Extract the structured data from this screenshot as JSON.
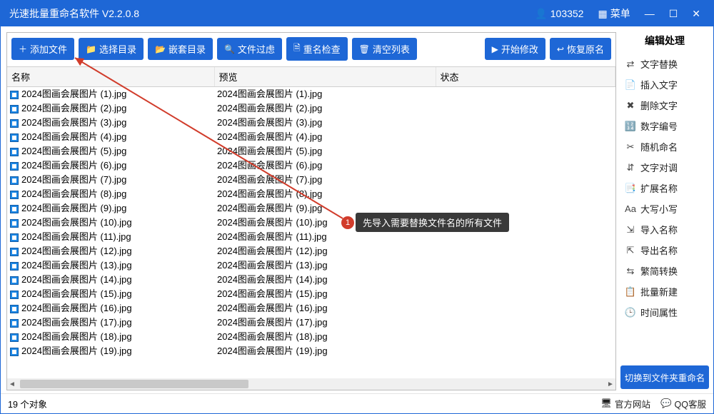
{
  "title": "光速批量重命名软件 V2.2.0.8",
  "titlebar": {
    "user_id": "103352",
    "menu": "菜单",
    "min": "—",
    "max": "☐",
    "close": "✕"
  },
  "toolbar": {
    "add_file": "添加文件",
    "select_dir": "选择目录",
    "nested_dir": "嵌套目录",
    "file_filter": "文件过虑",
    "rename_check": "重名检查",
    "clear_list": "清空列表",
    "start_modify": "开始修改",
    "restore_name": "恢复原名"
  },
  "columns": {
    "name": "名称",
    "preview": "预览",
    "status": "状态"
  },
  "files": [
    {
      "name": "2024图画会展图片 (1).jpg",
      "preview": "2024图画会展图片 (1).jpg"
    },
    {
      "name": "2024图画会展图片 (2).jpg",
      "preview": "2024图画会展图片 (2).jpg"
    },
    {
      "name": "2024图画会展图片 (3).jpg",
      "preview": "2024图画会展图片 (3).jpg"
    },
    {
      "name": "2024图画会展图片 (4).jpg",
      "preview": "2024图画会展图片 (4).jpg"
    },
    {
      "name": "2024图画会展图片 (5).jpg",
      "preview": "2024图画会展图片 (5).jpg"
    },
    {
      "name": "2024图画会展图片 (6).jpg",
      "preview": "2024图画会展图片 (6).jpg"
    },
    {
      "name": "2024图画会展图片 (7).jpg",
      "preview": "2024图画会展图片 (7).jpg"
    },
    {
      "name": "2024图画会展图片 (8).jpg",
      "preview": "2024图画会展图片 (8).jpg"
    },
    {
      "name": "2024图画会展图片 (9).jpg",
      "preview": "2024图画会展图片 (9).jpg"
    },
    {
      "name": "2024图画会展图片 (10).jpg",
      "preview": "2024图画会展图片 (10).jpg"
    },
    {
      "name": "2024图画会展图片 (11).jpg",
      "preview": "2024图画会展图片 (11).jpg"
    },
    {
      "name": "2024图画会展图片 (12).jpg",
      "preview": "2024图画会展图片 (12).jpg"
    },
    {
      "name": "2024图画会展图片 (13).jpg",
      "preview": "2024图画会展图片 (13).jpg"
    },
    {
      "name": "2024图画会展图片 (14).jpg",
      "preview": "2024图画会展图片 (14).jpg"
    },
    {
      "name": "2024图画会展图片 (15).jpg",
      "preview": "2024图画会展图片 (15).jpg"
    },
    {
      "name": "2024图画会展图片 (16).jpg",
      "preview": "2024图画会展图片 (16).jpg"
    },
    {
      "name": "2024图画会展图片 (17).jpg",
      "preview": "2024图画会展图片 (17).jpg"
    },
    {
      "name": "2024图画会展图片 (18).jpg",
      "preview": "2024图画会展图片 (18).jpg"
    },
    {
      "name": "2024图画会展图片 (19).jpg",
      "preview": "2024图画会展图片 (19).jpg"
    }
  ],
  "sidebar": {
    "title": "编辑处理",
    "items": [
      {
        "icon": "⇄",
        "label": "文字替换"
      },
      {
        "icon": "📄",
        "label": "插入文字"
      },
      {
        "icon": "✖",
        "label": "删除文字"
      },
      {
        "icon": "🔢",
        "label": "数字编号"
      },
      {
        "icon": "✂",
        "label": "随机命名"
      },
      {
        "icon": "⇵",
        "label": "文字对调"
      },
      {
        "icon": "📑",
        "label": "扩展名称"
      },
      {
        "icon": "Aa",
        "label": "大写小写"
      },
      {
        "icon": "⇲",
        "label": "导入名称"
      },
      {
        "icon": "⇱",
        "label": "导出名称"
      },
      {
        "icon": "⇆",
        "label": "繁简转换"
      },
      {
        "icon": "📋",
        "label": "批量新建"
      },
      {
        "icon": "🕒",
        "label": "时间属性"
      }
    ],
    "switch_btn": "切换到文件夹重命名"
  },
  "status": {
    "count_text": "19 个对象",
    "official_site": "官方网站",
    "qq_support": "QQ客服"
  },
  "annotation": {
    "num": "1",
    "text": "先导入需要替换文件名的所有文件"
  }
}
